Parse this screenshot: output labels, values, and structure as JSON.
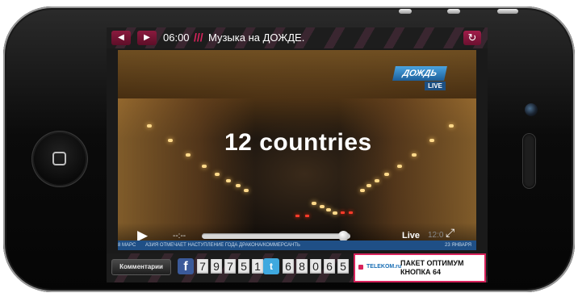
{
  "topbar": {
    "prev_glyph": "◀",
    "next_glyph": "▶",
    "time": "06:00",
    "slashes": "///",
    "show_title": "Музыка на ДОЖДЕ.",
    "refresh_glyph": "↻"
  },
  "video": {
    "overlay_text": "12 countries",
    "channel_logo": "ДОЖДЬ",
    "channel_live": "LIVE",
    "play_glyph": "▶",
    "current_time": "--:--",
    "progress": 0.95,
    "live_label": "Live",
    "stream_time": "12:0",
    "fullscreen_glyph": "⤢",
    "ticker": [
      "8 МАРС",
      "АЗИЯ ОТМЕЧАЕТ НАСТУПЛЕНИЕ ГОДА ДРАКОНА/КОММЕРСАНТЬ",
      "23 ЯНВАРЯ"
    ]
  },
  "social": {
    "comments_label": "Комментарии",
    "facebook_icon": "facebook-icon",
    "facebook_glyph": "f",
    "facebook_count": [
      "7",
      "9",
      "7",
      "5",
      "1"
    ],
    "twitter_icon": "twitter-icon",
    "twitter_glyph": "t",
    "twitter_count": [
      "6",
      "8",
      "0",
      "6",
      "5"
    ]
  },
  "ad": {
    "logo": "TELEKOM.ru",
    "line1": "ПАКЕТ ОПТИМУМ",
    "line2": "КНОПКА 64"
  },
  "colors": {
    "accent": "#d8235c",
    "facebook": "#3b5a9a",
    "twitter": "#3fa9df",
    "ticker": "#1f4f86"
  }
}
